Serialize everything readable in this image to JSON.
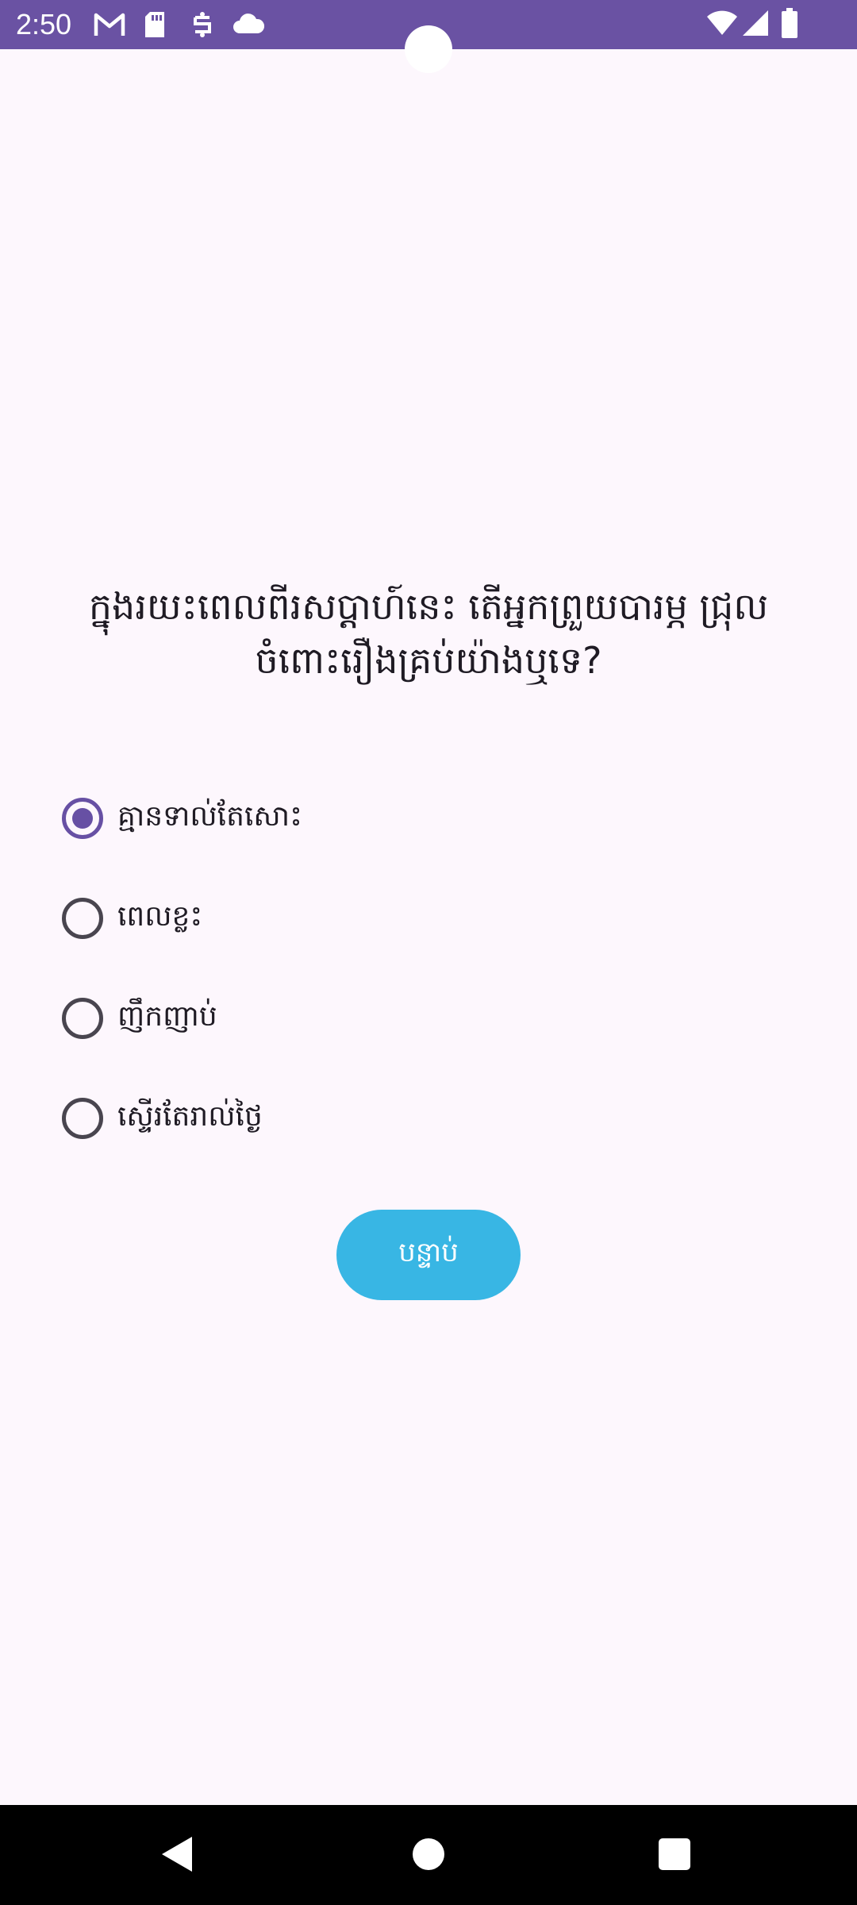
{
  "status_bar": {
    "time": "2:50",
    "left_icons": [
      "gmail-icon",
      "sd-card-icon",
      "sync-icon",
      "cloud-icon"
    ],
    "right_icons": [
      "wifi-icon",
      "signal-icon",
      "battery-icon"
    ],
    "background": "#6a52a3"
  },
  "question": {
    "text": "ក្នុងរយះពេលពីរសប្ដាហ៍នេះ តើអ្នកព្រួយបារម្ភ ជ្រុលចំពោះរឿងគ្រប់យ៉ាងឬទេ?"
  },
  "options": [
    {
      "label": "គ្មានទាល់តែសោះ",
      "selected": true
    },
    {
      "label": "ពេលខ្លះ",
      "selected": false
    },
    {
      "label": "ញឹកញាប់",
      "selected": false
    },
    {
      "label": "ស្ទើរតែរាល់ថ្ងៃ",
      "selected": false
    }
  ],
  "next_button": {
    "label": "បន្ទាប់",
    "color": "#38b6e4"
  },
  "accent_color": "#6750a4",
  "nav_bar": {
    "icons": [
      "back-icon",
      "home-icon",
      "recents-icon"
    ]
  }
}
